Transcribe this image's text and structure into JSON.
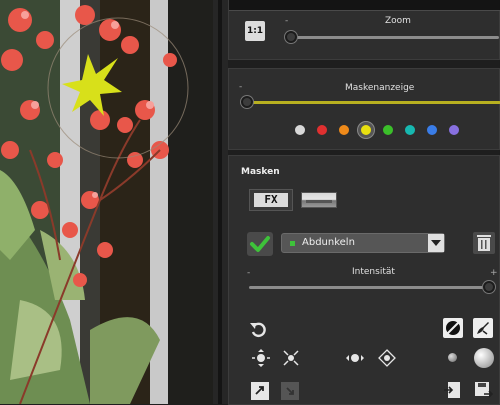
{
  "zoom": {
    "reset_label": "1:1",
    "label": "Zoom",
    "minus": "-",
    "value": 0.0
  },
  "mask_display": {
    "label": "Maskenanzeige",
    "minus": "-",
    "value": 0.0,
    "colors": [
      "#d8d8d8",
      "#e03030",
      "#ef8a1a",
      "#e8e010",
      "#3bbf2a",
      "#17b8b0",
      "#3a7de8",
      "#8870e0"
    ],
    "selected_index": 3
  },
  "masks": {
    "title": "Masken",
    "fx_label": "FX",
    "mode_select": {
      "value": "Abdunkeln"
    },
    "intensity": {
      "label": "Intensität",
      "minus": "-",
      "plus": "+",
      "value": 1.0
    }
  },
  "colors": {
    "accent_line": "#b8b020",
    "check_green": "#3ec23a"
  }
}
